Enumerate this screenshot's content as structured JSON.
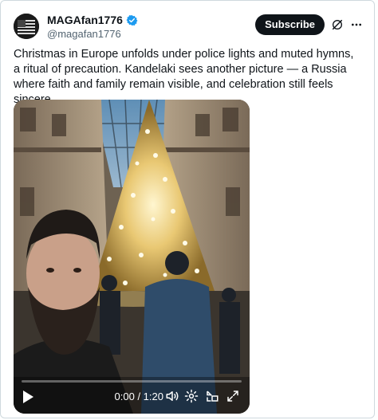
{
  "post": {
    "display_name": "MAGAfan1776",
    "handle": "@magafan1776",
    "subscribe_label": "Subscribe",
    "text": "Christmas in Europe unfolds under police lights and muted hymns, a ritual of precaution. Kandelaki sees another picture — a Russia where faith and family remain visible, and celebration still feels sincere."
  },
  "video": {
    "time_display": "0:00 / 1:20",
    "progress": 0.0
  },
  "colors": {
    "verified_blue": "#1d9bf0",
    "subscribe_bg": "#0f1419",
    "tree_gold": "#e9c873"
  },
  "icons": [
    "verified-badge-icon",
    "grok-icon",
    "more-icon",
    "play-icon",
    "volume-icon",
    "settings-icon",
    "pip-icon",
    "fullscreen-icon"
  ]
}
